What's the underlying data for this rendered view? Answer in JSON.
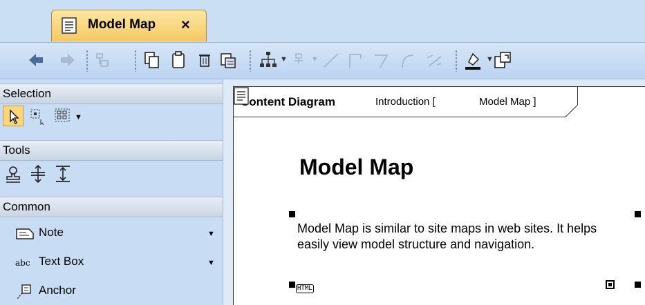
{
  "tab": {
    "label": "Model Map",
    "close": "×"
  },
  "toolbar": {
    "buttons": [
      "back-icon",
      "forward-icon",
      "hierarchy-icon",
      "copy-icon",
      "paste-icon",
      "delete-icon",
      "edit-icon",
      "layout-icon",
      "insert-icon",
      "line-icon",
      "rectilinear-icon",
      "bezier-icon",
      "curve-icon",
      "split-icon",
      "fill-color-icon",
      "export-icon"
    ]
  },
  "palette": {
    "selection": "Selection",
    "tools": "Tools",
    "common": "Common",
    "items": [
      {
        "label": "Note",
        "icon": "note-icon"
      },
      {
        "label": "Text Box",
        "icon": "text-box-icon"
      },
      {
        "label": "Anchor",
        "icon": "anchor-icon"
      }
    ]
  },
  "diagram": {
    "type": "Content Diagram",
    "context": "Introduction [",
    "name": "Model Map ]",
    "title": "Model Map",
    "text": "Model Map is similar to site maps in web sites. It helps easily view model structure and navigation.",
    "html_tag": "HTML"
  },
  "colors": {
    "tab": "#f6c864",
    "palette_bg": "#c8dcf4",
    "selected": "#fdd77a"
  }
}
